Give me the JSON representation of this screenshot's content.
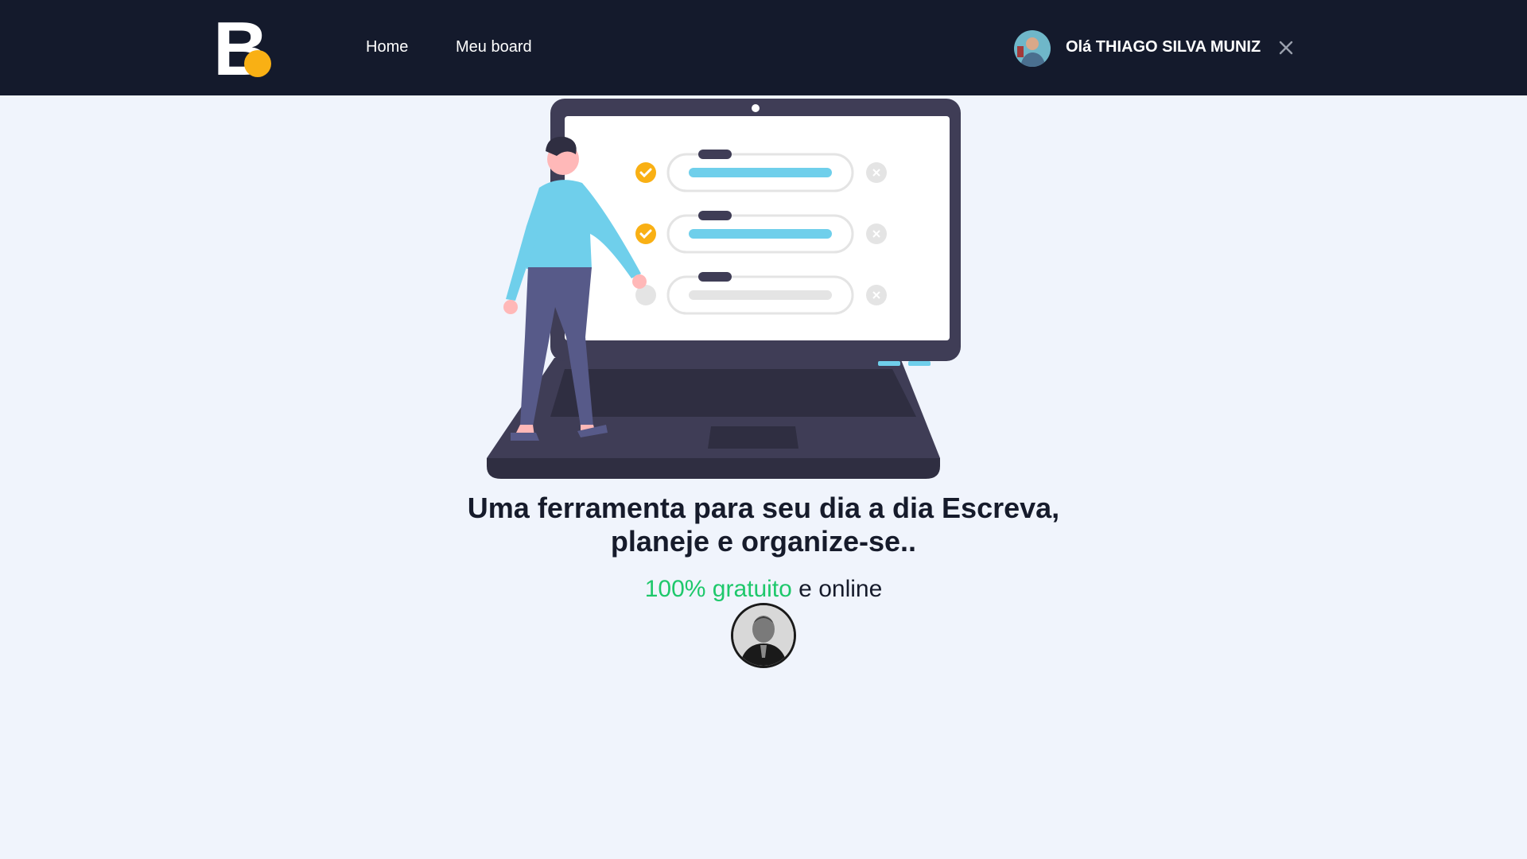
{
  "navbar": {
    "logo_letter": "B",
    "links": [
      {
        "label": "Home"
      },
      {
        "label": "Meu board"
      }
    ],
    "user": {
      "greeting": "Olá THIAGO SILVA MUNIZ"
    }
  },
  "hero": {
    "headline_line1": "Uma ferramenta para seu dia a dia Escreva,",
    "headline_line2": "planeje e organize-se..",
    "sub_accent": "100% gratuito",
    "sub_rest": " e online"
  },
  "icons": {
    "close": "close-icon",
    "check": "check-icon"
  },
  "colors": {
    "navbar_bg": "#141a2c",
    "page_bg": "#f0f4fc",
    "accent_yellow": "#f9b014",
    "accent_green": "#1ec86b",
    "illustration_blue": "#6fcfeb",
    "laptop_dark": "#3f3d56"
  }
}
